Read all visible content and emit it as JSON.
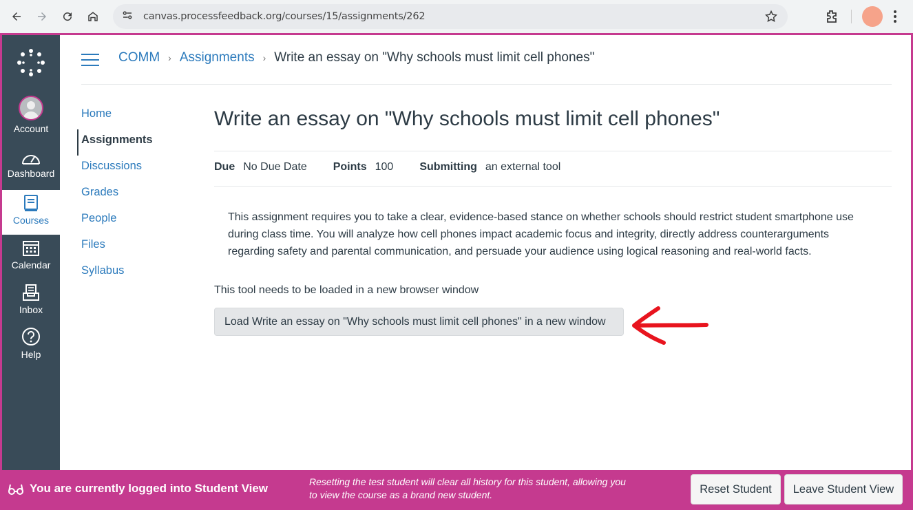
{
  "browser": {
    "url": "canvas.processfeedback.org/courses/15/assignments/262"
  },
  "global_nav": {
    "items": [
      {
        "label": "Account",
        "icon": "avatar"
      },
      {
        "label": "Dashboard",
        "icon": "dashboard-icon"
      },
      {
        "label": "Courses",
        "icon": "courses-icon",
        "active": true
      },
      {
        "label": "Calendar",
        "icon": "calendar-icon"
      },
      {
        "label": "Inbox",
        "icon": "inbox-icon"
      },
      {
        "label": "Help",
        "icon": "help-icon"
      }
    ]
  },
  "breadcrumb": {
    "course": "COMM",
    "section": "Assignments",
    "current": "Write an essay on \"Why schools must limit cell phones\""
  },
  "course_nav": {
    "items": [
      "Home",
      "Assignments",
      "Discussions",
      "Grades",
      "People",
      "Files",
      "Syllabus"
    ],
    "active": "Assignments"
  },
  "assignment": {
    "title": "Write an essay on \"Why schools must limit cell phones\"",
    "due_label": "Due",
    "due_value": "No Due Date",
    "points_label": "Points",
    "points_value": "100",
    "submitting_label": "Submitting",
    "submitting_value": "an external tool",
    "description": "This assignment requires you to take a clear, evidence-based stance on whether schools should restrict student smartphone use during class time. You will analyze how cell phones impact academic focus and integrity, directly address counterarguments regarding safety and parental communication, and persuade your audience using logical reasoning and real-world facts.",
    "tool_message": "This tool needs to be loaded in a new browser window",
    "load_button": "Load Write an essay on \"Why schools must limit cell phones\" in a new window"
  },
  "student_view": {
    "status": "You are currently logged into Student View",
    "note": "Resetting the test student will clear all history for this student, allowing you to view the course as a brand new student.",
    "reset_button": "Reset Student",
    "leave_button": "Leave Student View"
  },
  "colors": {
    "brand_nav": "#394b58",
    "link": "#2b7abc",
    "student_view": "#c53a8f",
    "annotation_arrow": "#e8141e"
  }
}
